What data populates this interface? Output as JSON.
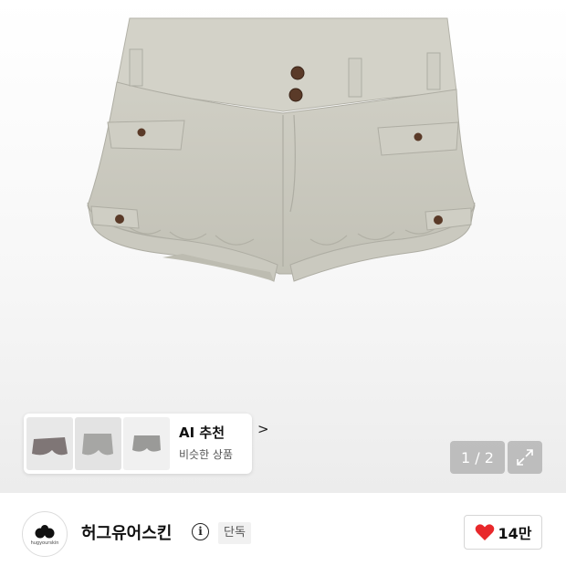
{
  "ai_recommend": {
    "title": "AI 추천",
    "chevron": ">",
    "subtitle": "비슷한 상품"
  },
  "gallery": {
    "pager": "1 / 2"
  },
  "brand": {
    "name": "허그유어스킨",
    "logo_text": "hugyourskin",
    "info_glyph": "i",
    "badge": "단독"
  },
  "like": {
    "count": "14만",
    "color": "#e8282b"
  },
  "colors": {
    "shorts_fabric": "#c9c8bd",
    "button_brown": "#5a3a28"
  },
  "icons": [
    "info-icon",
    "heart-icon",
    "expand-icon",
    "chevron-right-icon"
  ]
}
